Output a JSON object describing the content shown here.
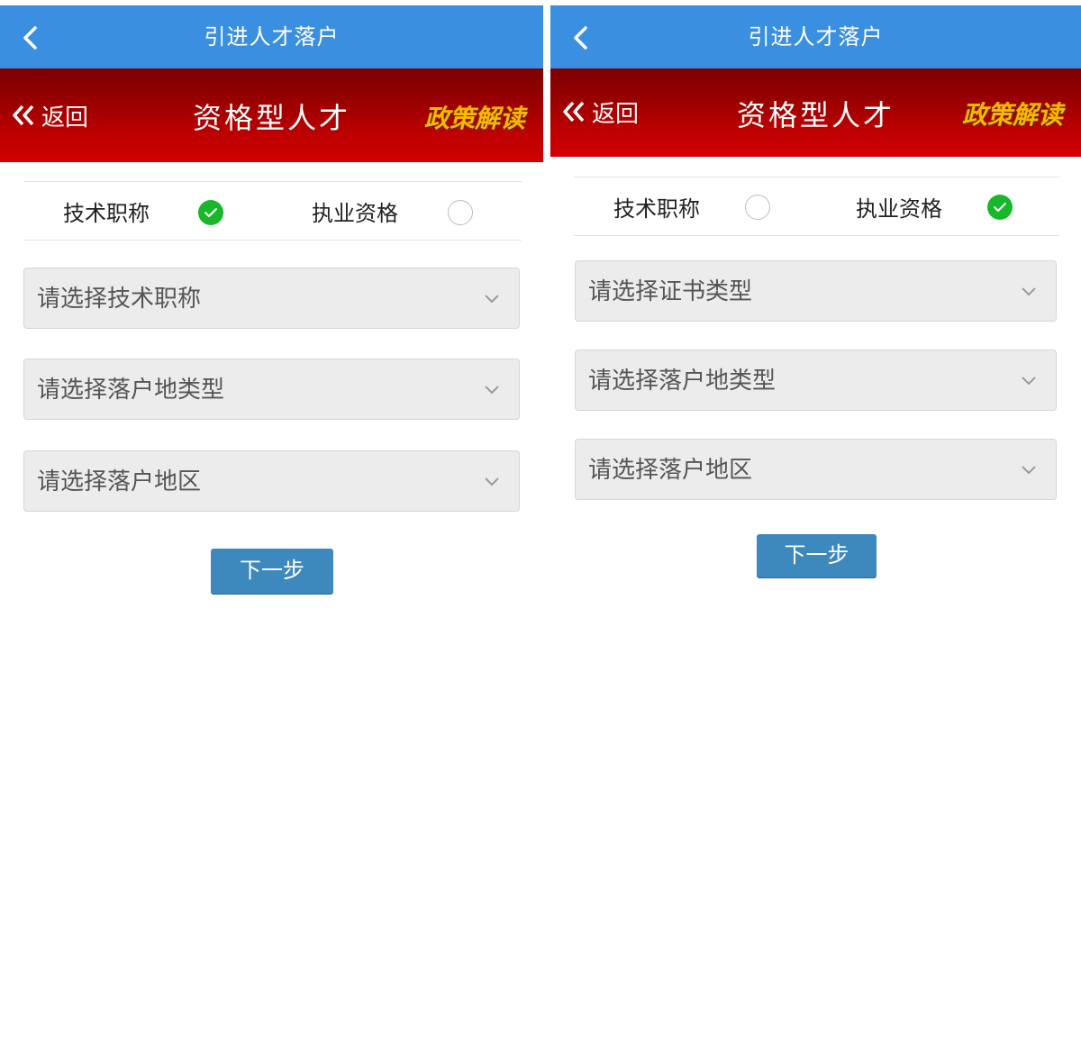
{
  "app_bar": {
    "title": "引进人才落户"
  },
  "banner": {
    "back_label": "返回",
    "title": "资格型人才",
    "policy_label": "政策解读"
  },
  "screens": [
    {
      "options": [
        {
          "label": "技术职称",
          "checked": true
        },
        {
          "label": "执业资格",
          "checked": false
        }
      ],
      "selects": [
        {
          "placeholder": "请选择技术职称"
        },
        {
          "placeholder": "请选择落户地类型"
        },
        {
          "placeholder": "请选择落户地区"
        }
      ],
      "next_label": "下一步"
    },
    {
      "options": [
        {
          "label": "技术职称",
          "checked": false
        },
        {
          "label": "执业资格",
          "checked": true
        }
      ],
      "selects": [
        {
          "placeholder": "请选择证书类型"
        },
        {
          "placeholder": "请选择落户地类型"
        },
        {
          "placeholder": "请选择落户地区"
        }
      ],
      "next_label": "下一步"
    }
  ],
  "colors": {
    "app_bar": "#3a8fe0",
    "banner_red": "#c00000",
    "policy_gold": "#ffb400",
    "check_green": "#19b82a",
    "button_blue": "#3d88bd"
  },
  "icons": [
    "back-chevron-icon",
    "double-chevron-left-icon",
    "checkmark-icon",
    "chevron-down-icon"
  ]
}
